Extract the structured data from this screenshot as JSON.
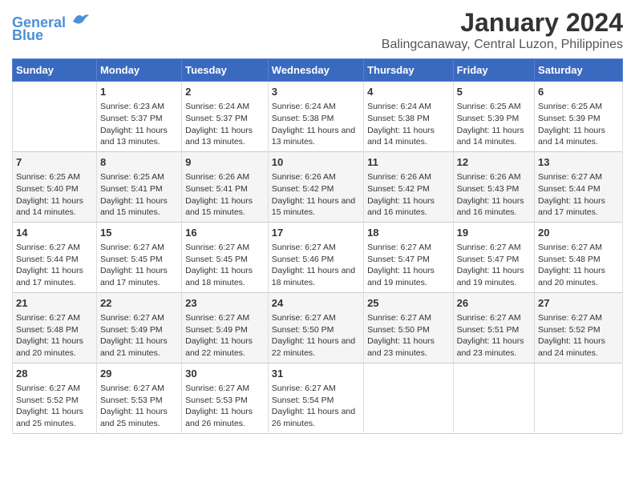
{
  "logo": {
    "line1": "General",
    "line2": "Blue"
  },
  "title": "January 2024",
  "subtitle": "Balingcanaway, Central Luzon, Philippines",
  "headers": [
    "Sunday",
    "Monday",
    "Tuesday",
    "Wednesday",
    "Thursday",
    "Friday",
    "Saturday"
  ],
  "weeks": [
    [
      {
        "day": "",
        "sunrise": "",
        "sunset": "",
        "daylight": ""
      },
      {
        "day": "1",
        "sunrise": "Sunrise: 6:23 AM",
        "sunset": "Sunset: 5:37 PM",
        "daylight": "Daylight: 11 hours and 13 minutes."
      },
      {
        "day": "2",
        "sunrise": "Sunrise: 6:24 AM",
        "sunset": "Sunset: 5:37 PM",
        "daylight": "Daylight: 11 hours and 13 minutes."
      },
      {
        "day": "3",
        "sunrise": "Sunrise: 6:24 AM",
        "sunset": "Sunset: 5:38 PM",
        "daylight": "Daylight: 11 hours and 13 minutes."
      },
      {
        "day": "4",
        "sunrise": "Sunrise: 6:24 AM",
        "sunset": "Sunset: 5:38 PM",
        "daylight": "Daylight: 11 hours and 14 minutes."
      },
      {
        "day": "5",
        "sunrise": "Sunrise: 6:25 AM",
        "sunset": "Sunset: 5:39 PM",
        "daylight": "Daylight: 11 hours and 14 minutes."
      },
      {
        "day": "6",
        "sunrise": "Sunrise: 6:25 AM",
        "sunset": "Sunset: 5:39 PM",
        "daylight": "Daylight: 11 hours and 14 minutes."
      }
    ],
    [
      {
        "day": "7",
        "sunrise": "Sunrise: 6:25 AM",
        "sunset": "Sunset: 5:40 PM",
        "daylight": "Daylight: 11 hours and 14 minutes."
      },
      {
        "day": "8",
        "sunrise": "Sunrise: 6:25 AM",
        "sunset": "Sunset: 5:41 PM",
        "daylight": "Daylight: 11 hours and 15 minutes."
      },
      {
        "day": "9",
        "sunrise": "Sunrise: 6:26 AM",
        "sunset": "Sunset: 5:41 PM",
        "daylight": "Daylight: 11 hours and 15 minutes."
      },
      {
        "day": "10",
        "sunrise": "Sunrise: 6:26 AM",
        "sunset": "Sunset: 5:42 PM",
        "daylight": "Daylight: 11 hours and 15 minutes."
      },
      {
        "day": "11",
        "sunrise": "Sunrise: 6:26 AM",
        "sunset": "Sunset: 5:42 PM",
        "daylight": "Daylight: 11 hours and 16 minutes."
      },
      {
        "day": "12",
        "sunrise": "Sunrise: 6:26 AM",
        "sunset": "Sunset: 5:43 PM",
        "daylight": "Daylight: 11 hours and 16 minutes."
      },
      {
        "day": "13",
        "sunrise": "Sunrise: 6:27 AM",
        "sunset": "Sunset: 5:44 PM",
        "daylight": "Daylight: 11 hours and 17 minutes."
      }
    ],
    [
      {
        "day": "14",
        "sunrise": "Sunrise: 6:27 AM",
        "sunset": "Sunset: 5:44 PM",
        "daylight": "Daylight: 11 hours and 17 minutes."
      },
      {
        "day": "15",
        "sunrise": "Sunrise: 6:27 AM",
        "sunset": "Sunset: 5:45 PM",
        "daylight": "Daylight: 11 hours and 17 minutes."
      },
      {
        "day": "16",
        "sunrise": "Sunrise: 6:27 AM",
        "sunset": "Sunset: 5:45 PM",
        "daylight": "Daylight: 11 hours and 18 minutes."
      },
      {
        "day": "17",
        "sunrise": "Sunrise: 6:27 AM",
        "sunset": "Sunset: 5:46 PM",
        "daylight": "Daylight: 11 hours and 18 minutes."
      },
      {
        "day": "18",
        "sunrise": "Sunrise: 6:27 AM",
        "sunset": "Sunset: 5:47 PM",
        "daylight": "Daylight: 11 hours and 19 minutes."
      },
      {
        "day": "19",
        "sunrise": "Sunrise: 6:27 AM",
        "sunset": "Sunset: 5:47 PM",
        "daylight": "Daylight: 11 hours and 19 minutes."
      },
      {
        "day": "20",
        "sunrise": "Sunrise: 6:27 AM",
        "sunset": "Sunset: 5:48 PM",
        "daylight": "Daylight: 11 hours and 20 minutes."
      }
    ],
    [
      {
        "day": "21",
        "sunrise": "Sunrise: 6:27 AM",
        "sunset": "Sunset: 5:48 PM",
        "daylight": "Daylight: 11 hours and 20 minutes."
      },
      {
        "day": "22",
        "sunrise": "Sunrise: 6:27 AM",
        "sunset": "Sunset: 5:49 PM",
        "daylight": "Daylight: 11 hours and 21 minutes."
      },
      {
        "day": "23",
        "sunrise": "Sunrise: 6:27 AM",
        "sunset": "Sunset: 5:49 PM",
        "daylight": "Daylight: 11 hours and 22 minutes."
      },
      {
        "day": "24",
        "sunrise": "Sunrise: 6:27 AM",
        "sunset": "Sunset: 5:50 PM",
        "daylight": "Daylight: 11 hours and 22 minutes."
      },
      {
        "day": "25",
        "sunrise": "Sunrise: 6:27 AM",
        "sunset": "Sunset: 5:50 PM",
        "daylight": "Daylight: 11 hours and 23 minutes."
      },
      {
        "day": "26",
        "sunrise": "Sunrise: 6:27 AM",
        "sunset": "Sunset: 5:51 PM",
        "daylight": "Daylight: 11 hours and 23 minutes."
      },
      {
        "day": "27",
        "sunrise": "Sunrise: 6:27 AM",
        "sunset": "Sunset: 5:52 PM",
        "daylight": "Daylight: 11 hours and 24 minutes."
      }
    ],
    [
      {
        "day": "28",
        "sunrise": "Sunrise: 6:27 AM",
        "sunset": "Sunset: 5:52 PM",
        "daylight": "Daylight: 11 hours and 25 minutes."
      },
      {
        "day": "29",
        "sunrise": "Sunrise: 6:27 AM",
        "sunset": "Sunset: 5:53 PM",
        "daylight": "Daylight: 11 hours and 25 minutes."
      },
      {
        "day": "30",
        "sunrise": "Sunrise: 6:27 AM",
        "sunset": "Sunset: 5:53 PM",
        "daylight": "Daylight: 11 hours and 26 minutes."
      },
      {
        "day": "31",
        "sunrise": "Sunrise: 6:27 AM",
        "sunset": "Sunset: 5:54 PM",
        "daylight": "Daylight: 11 hours and 26 minutes."
      },
      {
        "day": "",
        "sunrise": "",
        "sunset": "",
        "daylight": ""
      },
      {
        "day": "",
        "sunrise": "",
        "sunset": "",
        "daylight": ""
      },
      {
        "day": "",
        "sunrise": "",
        "sunset": "",
        "daylight": ""
      }
    ]
  ]
}
